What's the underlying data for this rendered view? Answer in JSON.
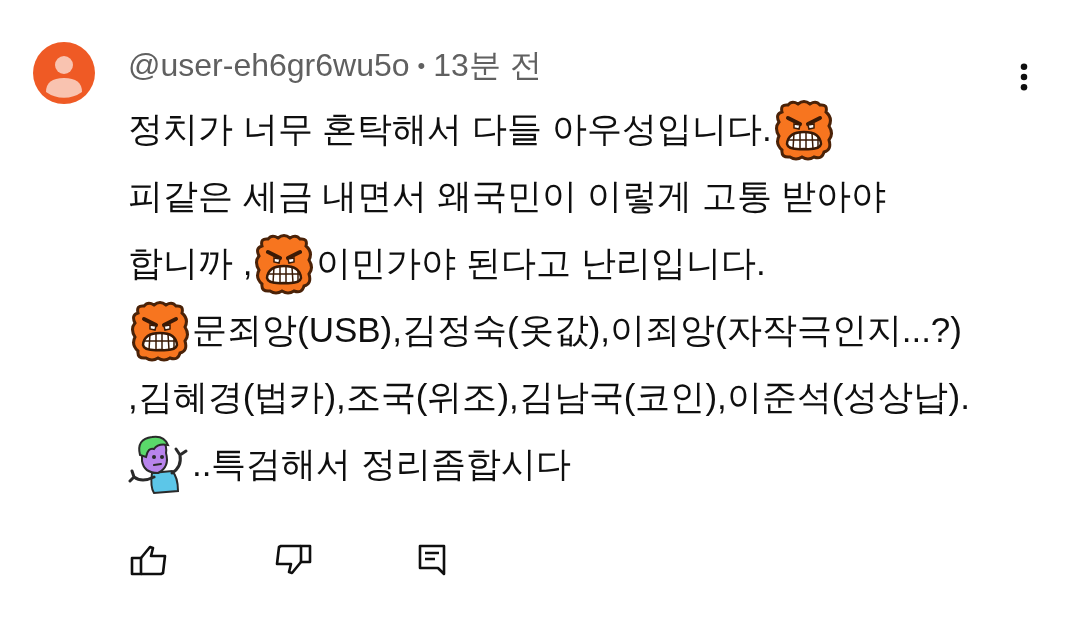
{
  "comment": {
    "author": "@user-eh6gr6wu5o",
    "separator": "•",
    "time": "13분 전",
    "lines": [
      [
        {
          "kind": "text",
          "text": "정치가 너무 혼탁해서 다들 아우성입니다."
        },
        {
          "kind": "angry_sticker"
        }
      ],
      [
        {
          "kind": "text",
          "text": "피같은 세금 내면서 왜국민이 이렇게 고통 받아야"
        }
      ],
      [
        {
          "kind": "text",
          "text": "합니까 ,"
        },
        {
          "kind": "angry_sticker"
        },
        {
          "kind": "text",
          "text": "이민가야 된다고 난리입니다."
        }
      ],
      [
        {
          "kind": "angry_sticker"
        },
        {
          "kind": "text",
          "text": "문죄앙(USB),김정숙(옷값),이죄앙(자작극인지...?)"
        }
      ],
      [
        {
          "kind": "text",
          "text": ",김혜경(법카),조국(위조),김남국(코인),이준석(성상납)."
        }
      ],
      [
        {
          "kind": "shrug_sticker"
        },
        {
          "kind": "text",
          "text": "..특검해서 정리좀합시다"
        }
      ]
    ]
  },
  "actions": [
    {
      "kind": "like"
    },
    {
      "kind": "dislike"
    },
    {
      "kind": "reply"
    }
  ]
}
